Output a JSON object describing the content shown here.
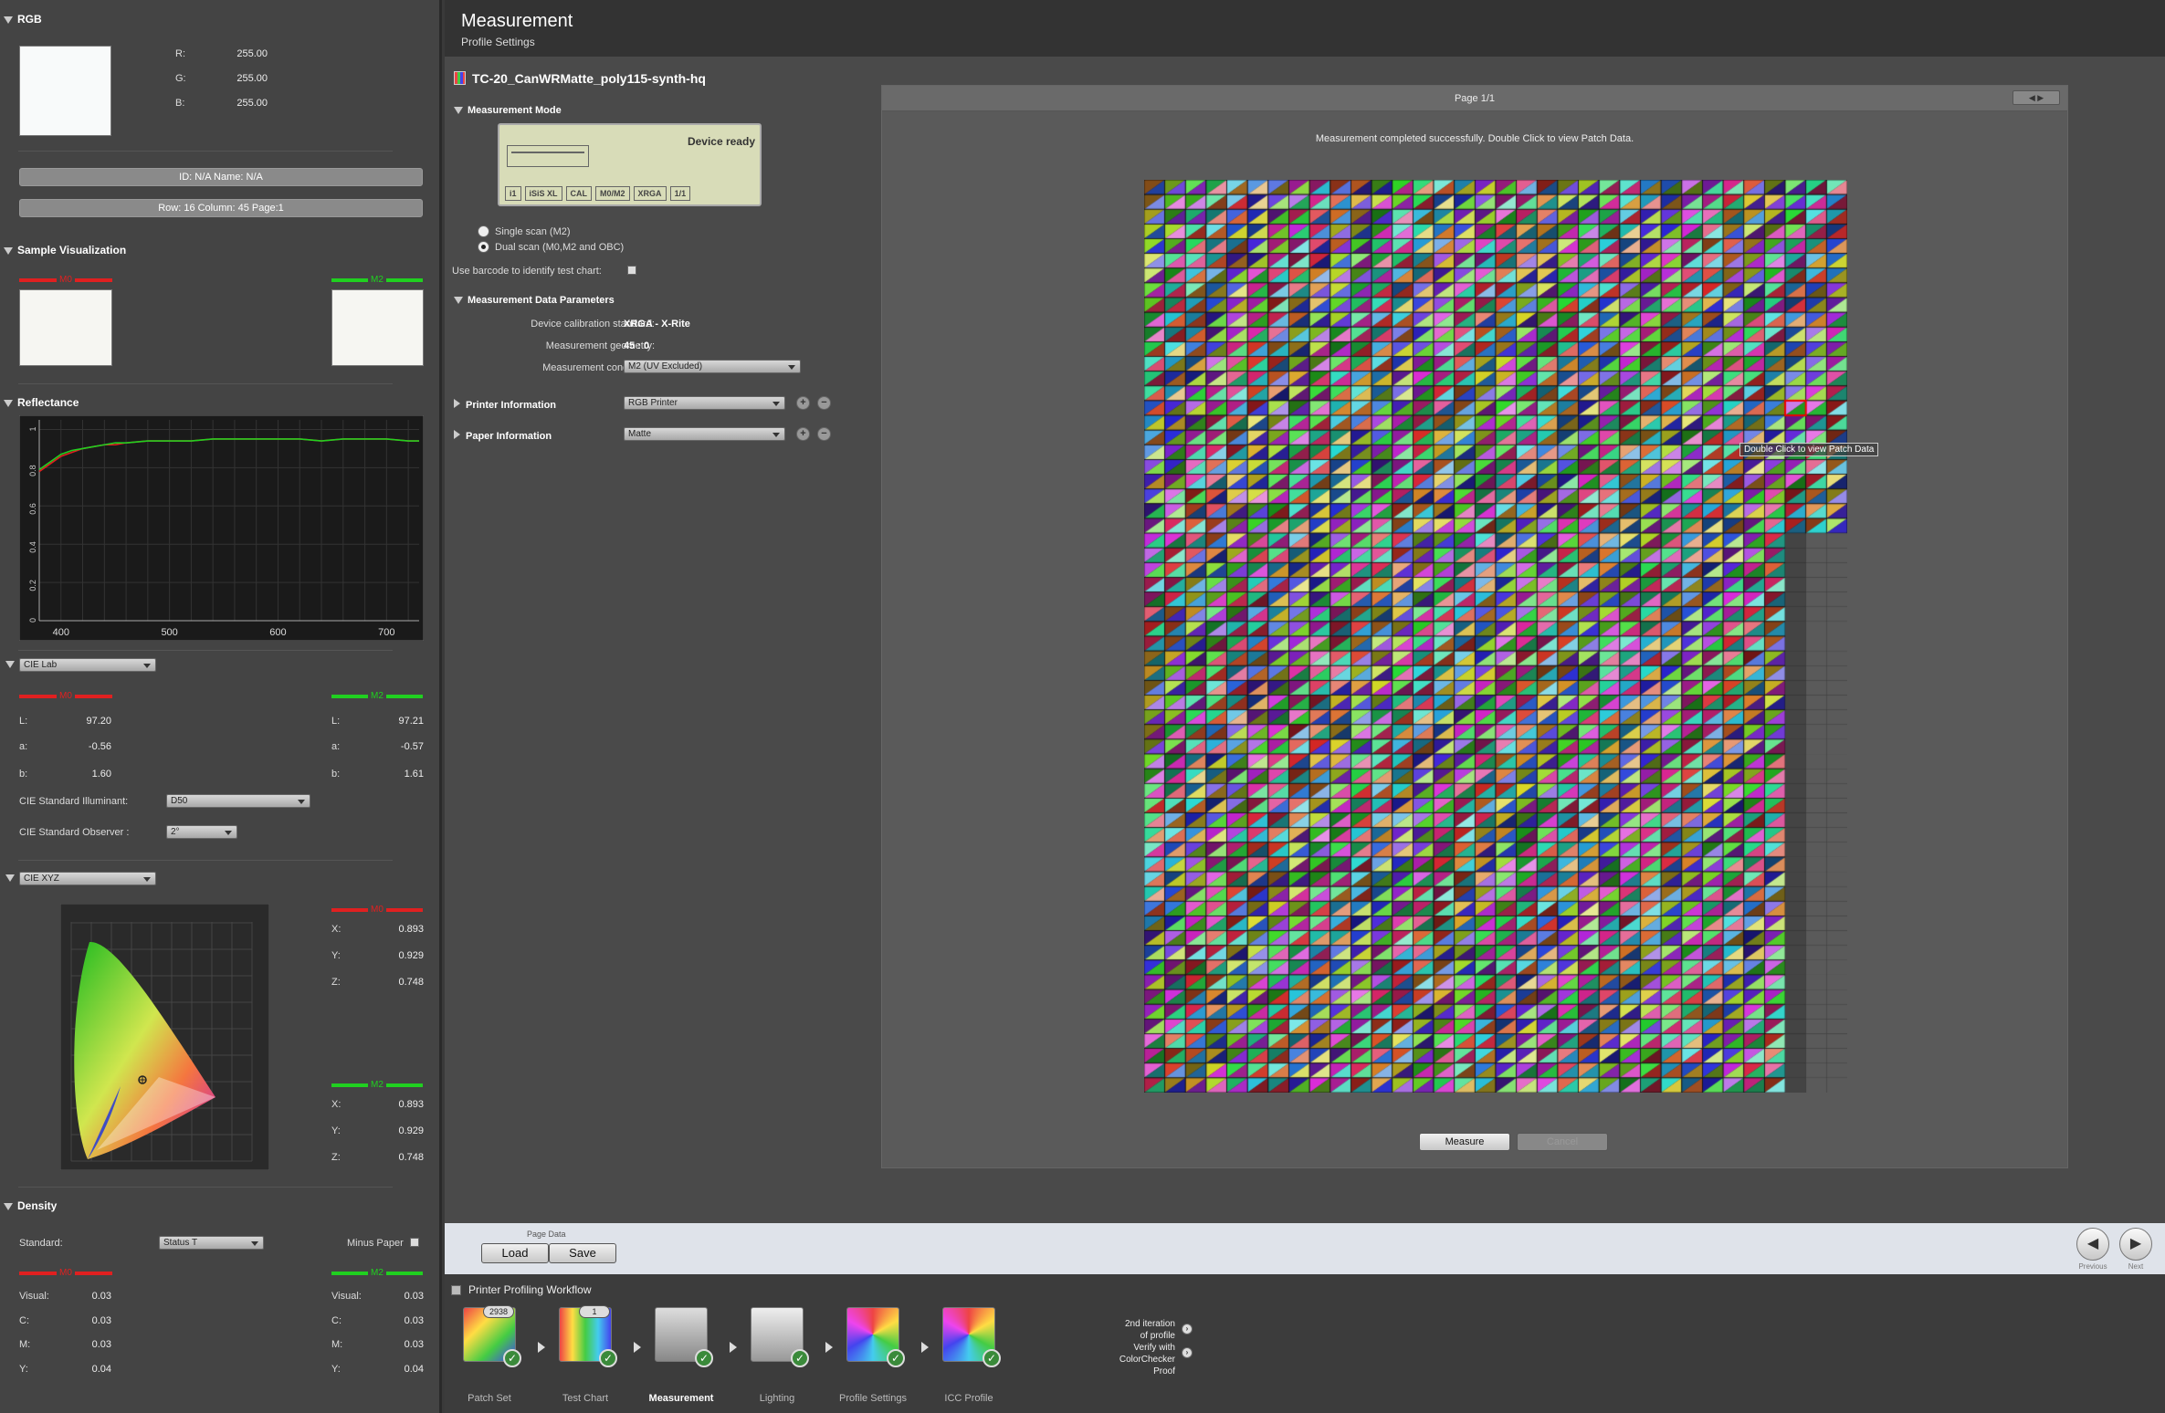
{
  "left": {
    "rgb": {
      "title": "RGB",
      "r_label": "R:",
      "g_label": "G:",
      "b_label": "B:",
      "r": "255.00",
      "g": "255.00",
      "b": "255.00"
    },
    "id_text": "ID: N/A    Name: N/A",
    "pos_text": "Row: 16    Column: 45    Page:1",
    "sample_vis": {
      "title": "Sample Visualization",
      "left_tag": "M0",
      "right_tag": "M2"
    },
    "reflectance": {
      "title": "Reflectance"
    },
    "lab": {
      "space": "CIE Lab",
      "m0_tag": "M0",
      "m2_tag": "M2",
      "l_label": "L:",
      "a_label": "a:",
      "b_label": "b:",
      "m0_l": "97.20",
      "m0_a": "-0.56",
      "m0_b": "1.60",
      "m2_l": "97.21",
      "m2_a": "-0.57",
      "m2_b": "1.61",
      "illuminant_label": "CIE Standard Illuminant:",
      "illuminant": "D50",
      "observer_label": "CIE Standard Observer :",
      "observer": "2°"
    },
    "xyz": {
      "space": "CIE XYZ",
      "m0_tag": "M0",
      "m2_tag": "M2",
      "x_label": "X:",
      "y_label": "Y:",
      "z_label": "Z:",
      "m0_x": "0.893",
      "m0_y": "0.929",
      "m0_z": "0.748",
      "m2_x": "0.893",
      "m2_y": "0.929",
      "m2_z": "0.748"
    },
    "density": {
      "title": "Density",
      "standard_label": "Standard:",
      "standard": "Status T",
      "minus_paper": "Minus Paper",
      "m0_tag": "M0",
      "m2_tag": "M2",
      "visual_label": "Visual:",
      "c_label": "C:",
      "m_label": "M:",
      "y_label": "Y:",
      "m0_visual": "0.03",
      "m0_c": "0.03",
      "m0_m": "0.03",
      "m0_y": "0.04",
      "m2_visual": "0.03",
      "m2_c": "0.03",
      "m2_m": "0.03",
      "m2_y": "0.04"
    }
  },
  "header": {
    "title": "Measurement",
    "subtitle": "Profile Settings"
  },
  "chart_name": "TC-20_CanWRMatte_poly115-synth-hq",
  "mode": {
    "title": "Measurement Mode",
    "device_status": "Device ready",
    "lcd_items": [
      "i1",
      "iSiS XL",
      "CAL",
      "M0/M2",
      "XRGA",
      "1/1"
    ],
    "single_scan": "Single scan (M2)",
    "dual_scan": "Dual scan (M0,M2 and OBC)",
    "barcode_label": "Use barcode to identify test chart:"
  },
  "params": {
    "title": "Measurement Data Parameters",
    "cal_label": "Device calibration standard:",
    "cal_value": "XRGA - X-Rite",
    "geom_label": "Measurement geometry:",
    "geom_value": "45 : 0",
    "cond_label": "Measurement conditions:",
    "cond_value": "M2 (UV Excluded)"
  },
  "printer": {
    "title": "Printer Information",
    "value": "RGB Printer"
  },
  "paper": {
    "title": "Paper Information",
    "value": "Matte"
  },
  "preview": {
    "page_label": "Page 1/1",
    "status": "Measurement completed successfully. Double Click to view Patch Data.",
    "tooltip": "Double Click to view Patch Data",
    "measure": "Measure",
    "cancel": "Cancel"
  },
  "page_data": {
    "label": "Page Data",
    "load": "Load",
    "save": "Save"
  },
  "nav": {
    "previous": "Previous",
    "next": "Next"
  },
  "workflow": {
    "title": "Printer Profiling Workflow",
    "steps": [
      {
        "label": "Patch Set",
        "badge": "2938"
      },
      {
        "label": "Test Chart",
        "badge": "1"
      },
      {
        "label": "Measurement",
        "badge": ""
      },
      {
        "label": "Lighting",
        "badge": ""
      },
      {
        "label": "Profile Settings",
        "badge": ""
      },
      {
        "label": "ICC Profile",
        "badge": ""
      }
    ],
    "iter_lines": [
      "2nd iteration",
      "of profile",
      "Verify with",
      "ColorChecker",
      "Proof"
    ]
  },
  "chart_data": {
    "type": "line",
    "title": "Reflectance",
    "x_ticks": [
      400,
      500,
      600,
      700
    ],
    "y_ticks": [
      0,
      0.2,
      0.4,
      0.6,
      0.8,
      1
    ],
    "xlim": [
      380,
      730
    ],
    "ylim": [
      0,
      1.05
    ],
    "series": [
      {
        "color": "#e02020",
        "x": [
          380,
          390,
          400,
          410,
          420,
          430,
          440,
          450,
          460,
          480,
          500,
          520,
          540,
          560,
          580,
          600,
          620,
          640,
          660,
          680,
          700,
          720,
          730
        ],
        "y": [
          0.78,
          0.82,
          0.86,
          0.88,
          0.9,
          0.91,
          0.92,
          0.92,
          0.93,
          0.94,
          0.94,
          0.94,
          0.95,
          0.95,
          0.95,
          0.95,
          0.95,
          0.94,
          0.95,
          0.95,
          0.95,
          0.94,
          0.94
        ]
      },
      {
        "color": "#20d020",
        "x": [
          380,
          390,
          400,
          410,
          420,
          430,
          440,
          450,
          460,
          480,
          500,
          520,
          540,
          560,
          580,
          600,
          620,
          640,
          660,
          680,
          700,
          720,
          730
        ],
        "y": [
          0.79,
          0.83,
          0.87,
          0.89,
          0.9,
          0.91,
          0.92,
          0.93,
          0.93,
          0.94,
          0.94,
          0.94,
          0.95,
          0.95,
          0.95,
          0.95,
          0.95,
          0.94,
          0.95,
          0.95,
          0.95,
          0.94,
          0.94
        ]
      }
    ]
  }
}
